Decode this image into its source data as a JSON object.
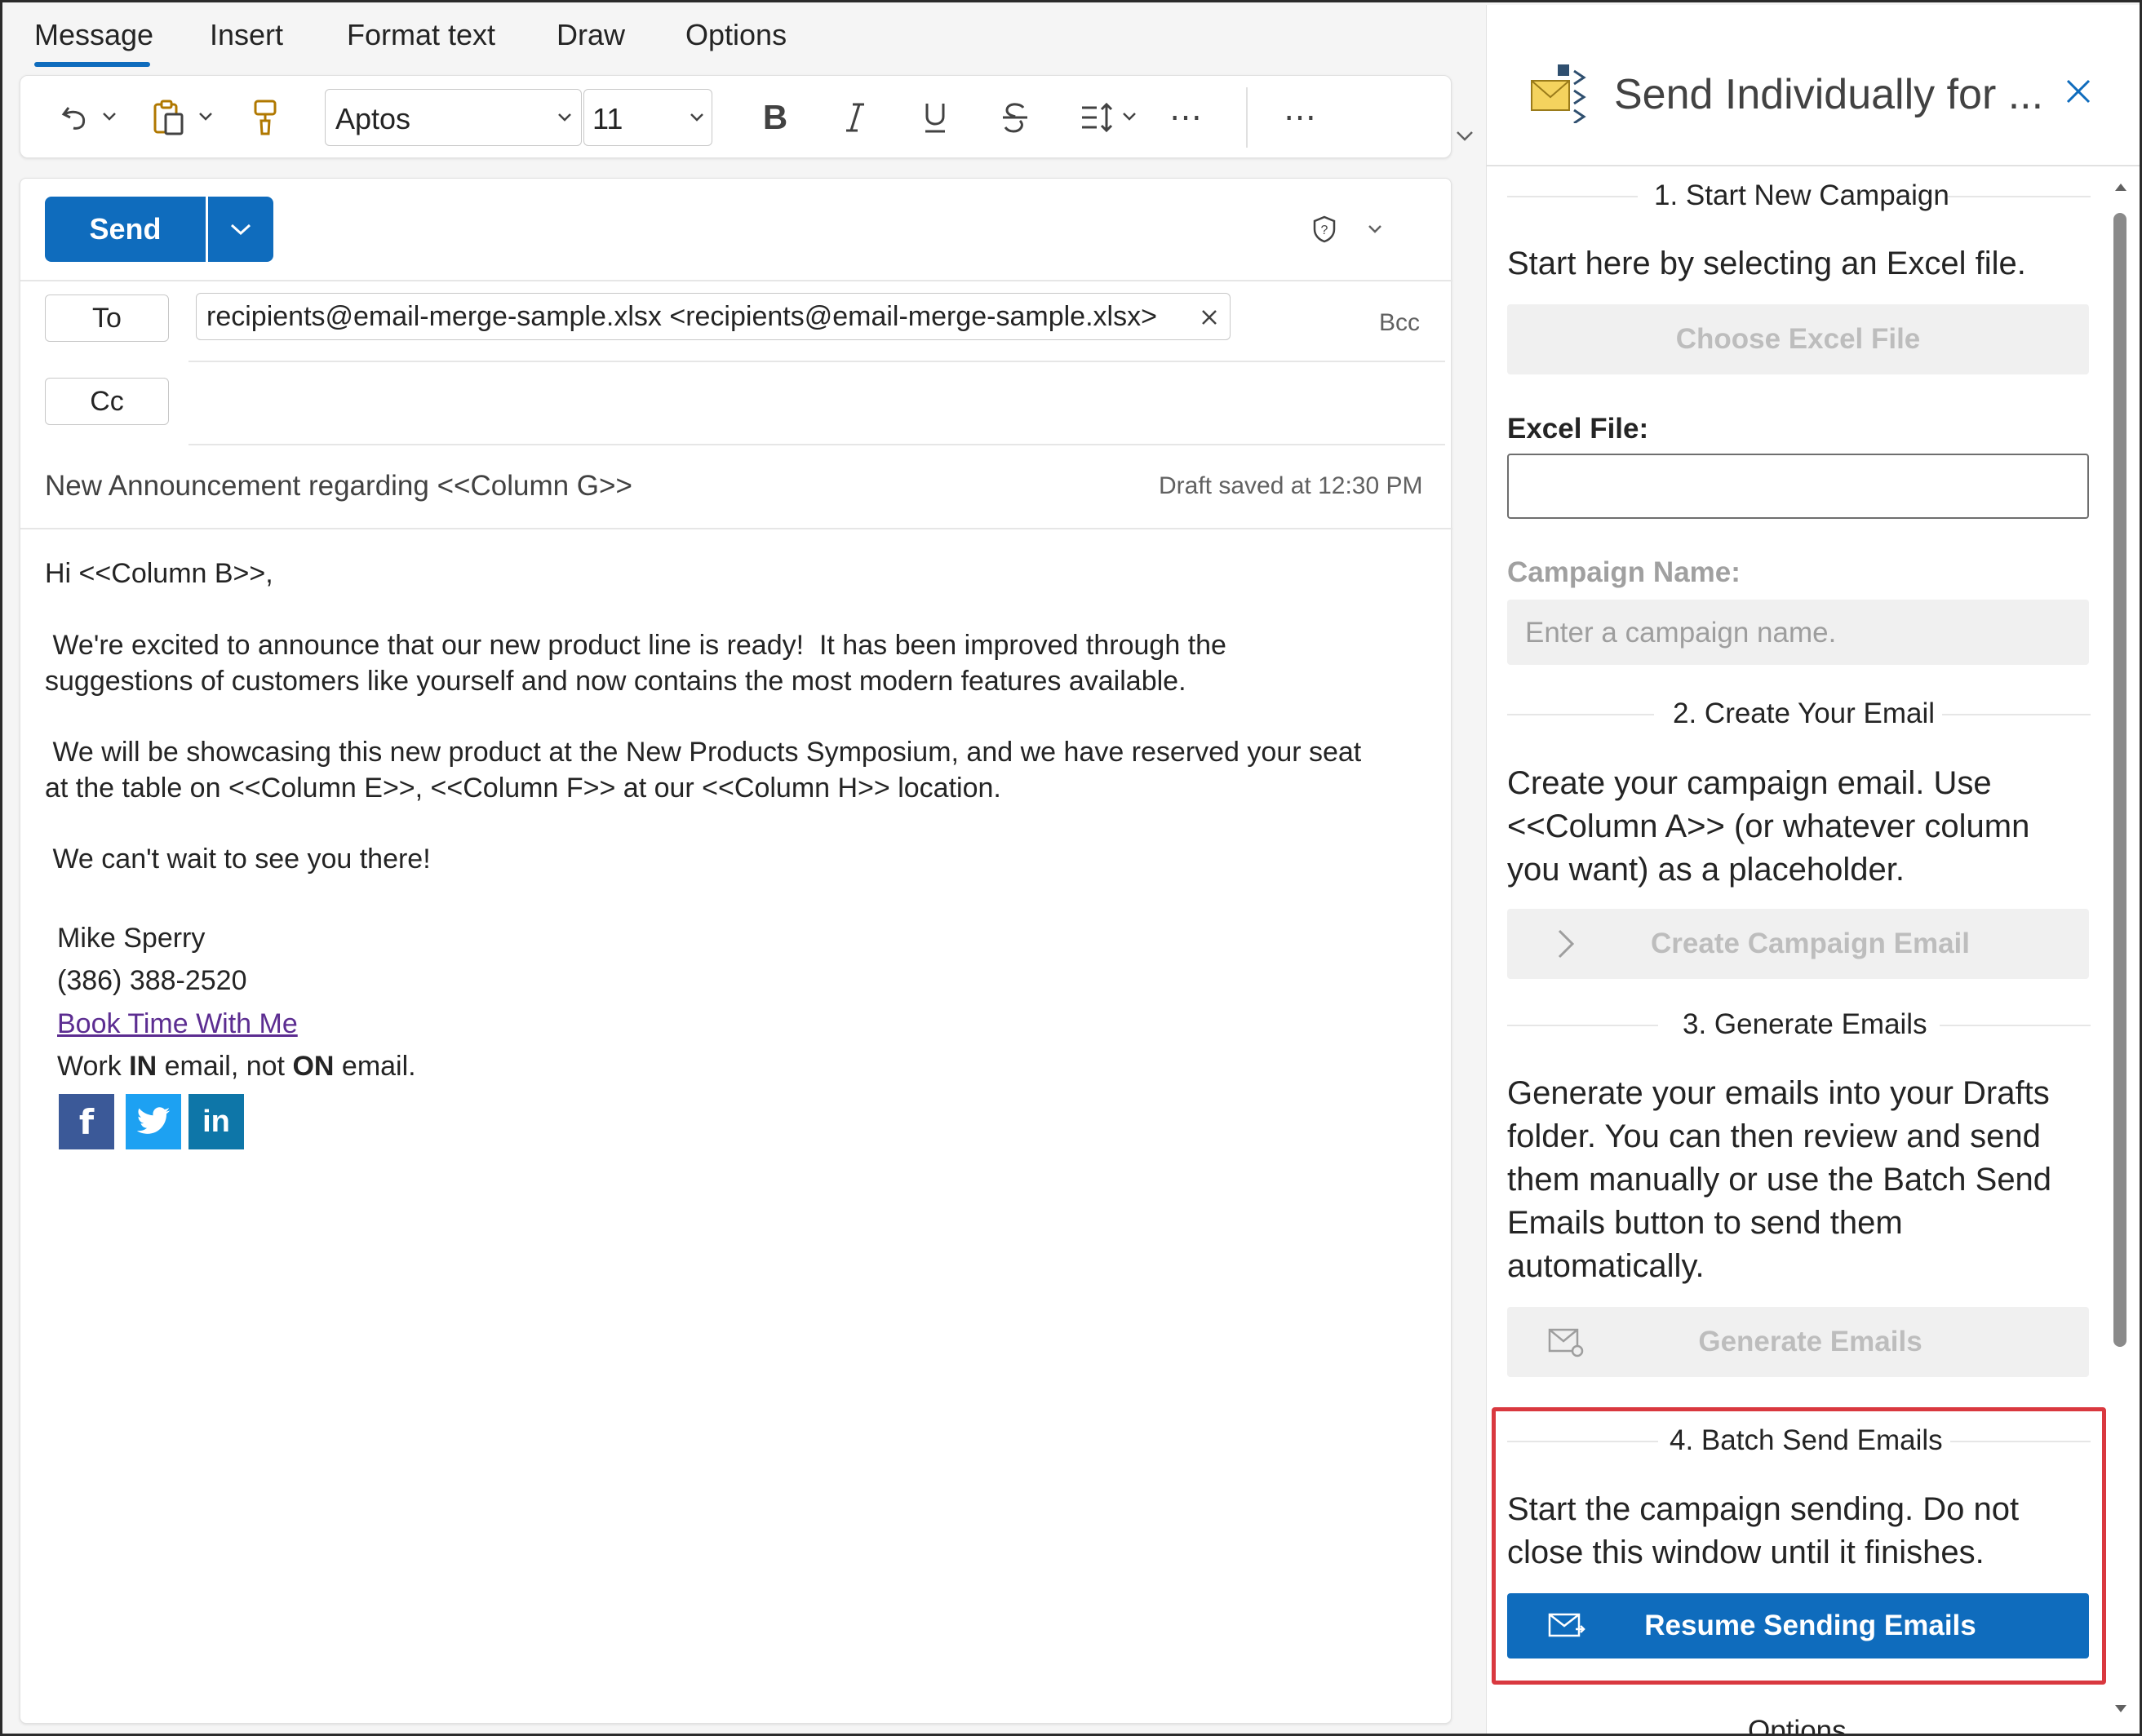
{
  "tabs": [
    "Message",
    "Insert",
    "Format text",
    "Draw",
    "Options"
  ],
  "ribbon": {
    "font_name": "Aptos",
    "font_size": "11",
    "icons": [
      "undo-icon",
      "clipboard-icon",
      "format-painter-icon",
      "bold-icon",
      "italic-icon",
      "underline-icon",
      "strikethrough-icon",
      "line-spacing-icon",
      "more-icon"
    ]
  },
  "compose": {
    "send_label": "Send",
    "to_label": "To",
    "cc_label": "Cc",
    "bcc_label": "Bcc",
    "recipient": "recipients@email-merge-sample.xlsx <recipients@email-merge-sample.xlsx>",
    "subject": "New Announcement regarding <<Column G>>",
    "draft_status": "Draft saved at 12:30 PM",
    "body": {
      "greeting": "Hi <<Column B>>,",
      "p1_line1": " We're excited to announce that our new product line is ready!  It has been improved through the",
      "p1_line2": "suggestions of customers like yourself and now contains the most modern features available.",
      "p2_line1": " We will be showcasing this new product at the New Products Symposium, and we have reserved your seat",
      "p2_line2": "at the table on <<Column E>>, <<Column F>> at our <<Column H>> location.",
      "p3": " We can't wait to see you there!",
      "sig_name": "Mike Sperry",
      "sig_phone": "(386) 388-2520",
      "sig_link": "Book Time With Me",
      "motto_a": "Work ",
      "motto_b": "IN",
      "motto_c": " email, not ",
      "motto_d": "ON",
      "motto_e": " email.",
      "social": [
        "f",
        "in"
      ]
    }
  },
  "pane": {
    "title": "Send Individually for ...",
    "s1_title": "1. Start New Campaign",
    "s1_text": "Start here by selecting an Excel file.",
    "choose_btn": "Choose Excel File",
    "excel_label": "Excel File:",
    "campaign_label": "Campaign Name:",
    "campaign_placeholder": "Enter a campaign name.",
    "s2_title": "2. Create Your Email",
    "s2_l1": "Create your campaign email. Use",
    "s2_l2": "<<Column A>> (or whatever column",
    "s2_l3": "you want) as a placeholder.",
    "create_btn": "Create Campaign Email",
    "s3_title": "3. Generate Emails",
    "s3_l1": "Generate your emails into your Drafts",
    "s3_l2": "folder. You can then review and send",
    "s3_l3": "them manually or use the Batch Send",
    "s3_l4": "Emails button to send them",
    "s3_l5": "automatically.",
    "generate_btn": "Generate Emails",
    "s4_title": "4. Batch Send Emails",
    "s4_l1": "Start the campaign sending. Do not",
    "s4_l2": "close this window until it finishes.",
    "resume_btn": "Resume Sending Emails",
    "options_label": "Options"
  },
  "colors": {
    "accent": "#0f6cbd",
    "highlight_border": "#d9383f",
    "link": "#5c2d91"
  }
}
